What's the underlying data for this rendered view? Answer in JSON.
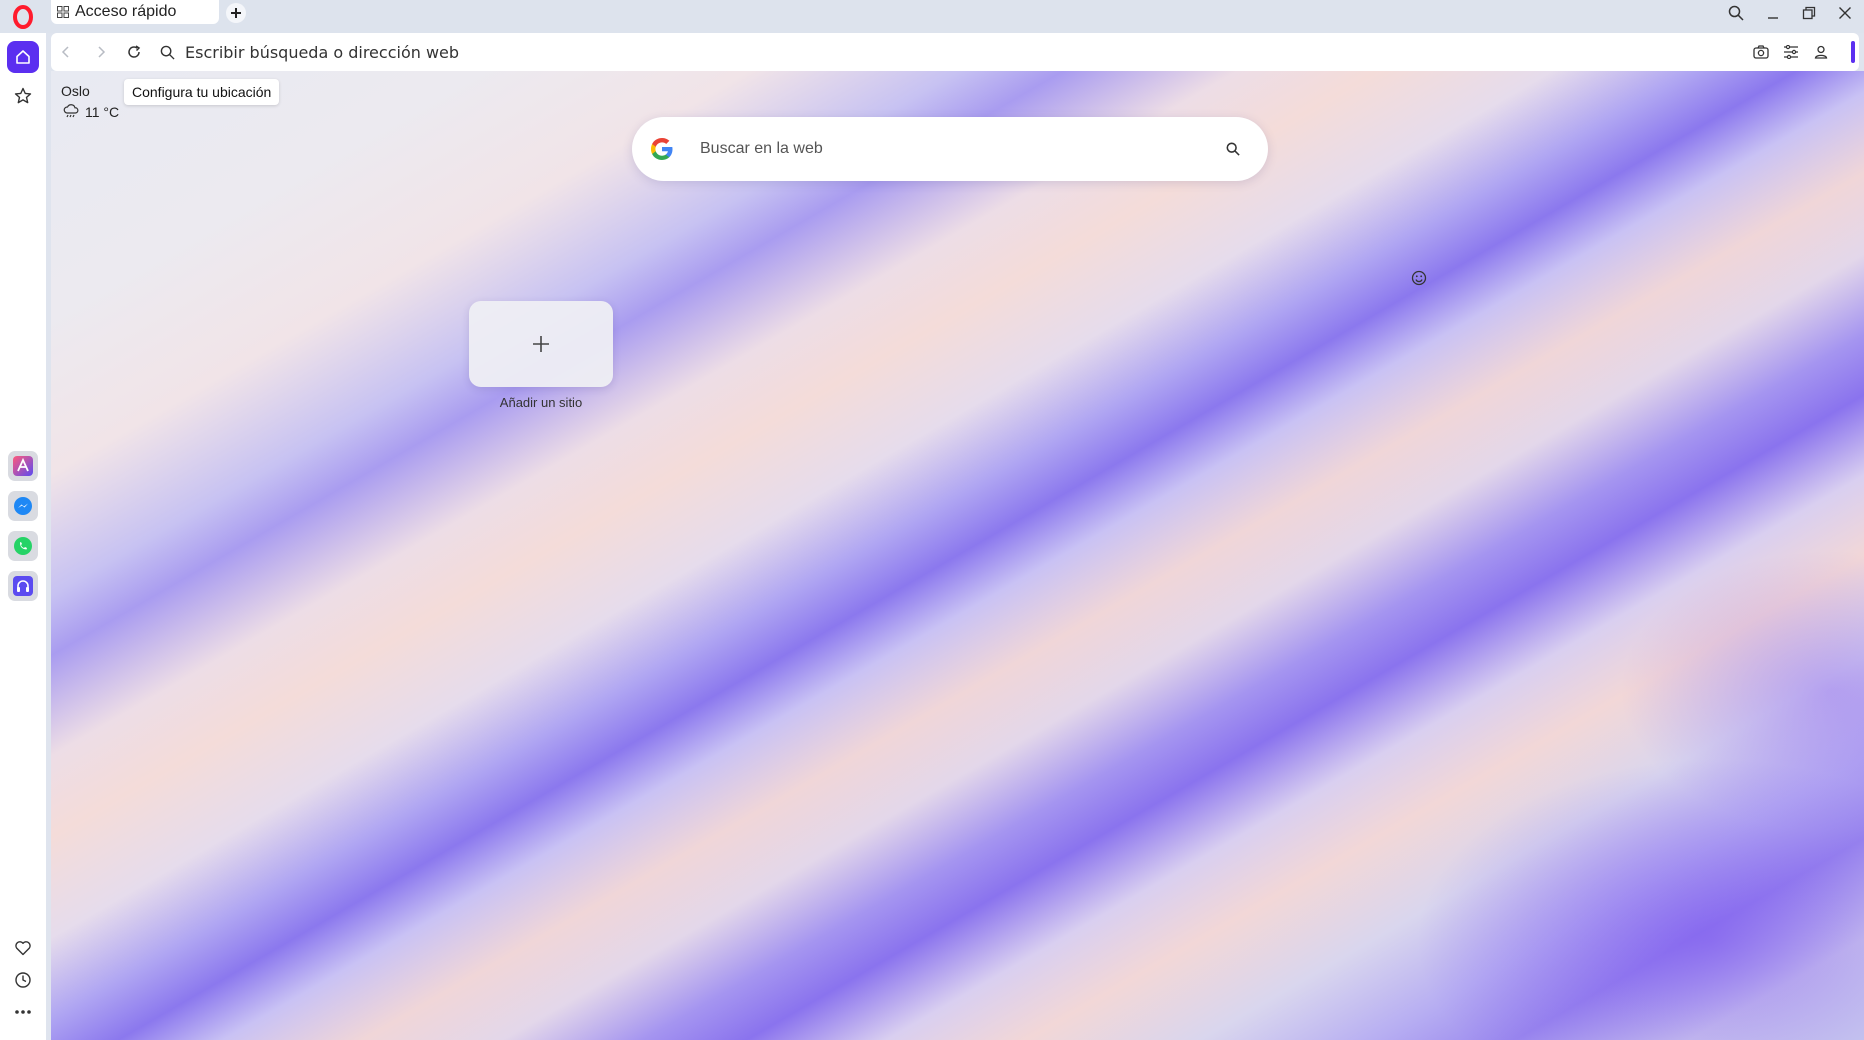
{
  "browser": {
    "tab": {
      "label": "Acceso rápido",
      "icon": "grid-icon"
    },
    "new_tab_icon": "plus-icon"
  },
  "toolbar": {
    "address_placeholder": "Escribir búsqueda o dirección web",
    "icons": [
      "back-icon",
      "forward-icon",
      "reload-icon",
      "search-icon",
      "camera-icon",
      "easy-setup-icon",
      "profile-icon"
    ]
  },
  "sidebar": {
    "top_items": [
      "home-icon",
      "speed-dial-star-icon"
    ],
    "apps": [
      "aria-icon",
      "messenger-icon",
      "whatsapp-icon",
      "music-player-icon"
    ],
    "bottom_items": [
      "favorites-heart-icon",
      "history-clock-icon",
      "more-icon"
    ]
  },
  "weather": {
    "city": "Oslo",
    "tooltip": "Configura tu ubicación",
    "temperature": "11 °C",
    "icon": "rain-cloud-icon"
  },
  "search": {
    "placeholder": "Buscar en la web",
    "engine_icon": "google-icon"
  },
  "speed_dial": {
    "add_label": "Añadir un sitio"
  },
  "colors": {
    "accent": "#5b2ff0",
    "opera_red": "#ff1b2d",
    "messenger": "#1e88f5",
    "whatsapp": "#25d366"
  }
}
